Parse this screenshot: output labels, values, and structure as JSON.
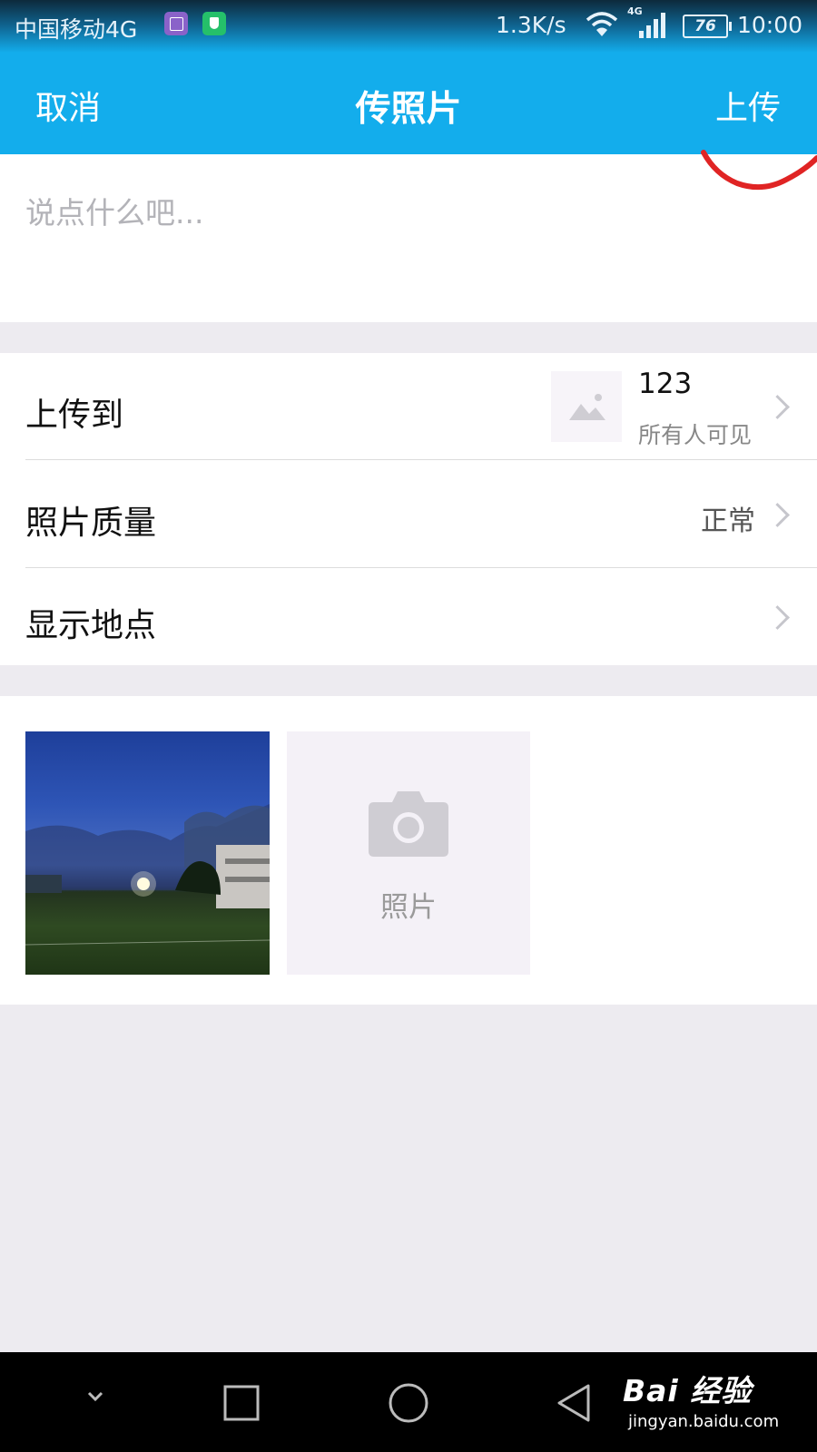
{
  "status_bar": {
    "carrier": "中国移动4G",
    "speed": "1.3K/s",
    "network_type": "4G",
    "battery": "76",
    "time": "10:00",
    "icons": [
      "gallery-icon",
      "shield-icon",
      "wifi-icon",
      "signal-icon",
      "battery-icon"
    ]
  },
  "nav": {
    "cancel": "取消",
    "title": "传照片",
    "upload": "上传"
  },
  "compose": {
    "placeholder": "说点什么吧...",
    "value": ""
  },
  "settings": {
    "upload_to": {
      "label": "上传到",
      "album_name": "123",
      "visibility": "所有人可见"
    },
    "quality": {
      "label": "照片质量",
      "value": "正常"
    },
    "location": {
      "label": "显示地点"
    }
  },
  "photos": {
    "add_label": "照片"
  },
  "watermark": {
    "brand": "Bai 经验",
    "url": "jingyan.baidu.com"
  },
  "colors": {
    "accent": "#13adec",
    "background": "#edebf0",
    "annotation": "#e02424"
  }
}
